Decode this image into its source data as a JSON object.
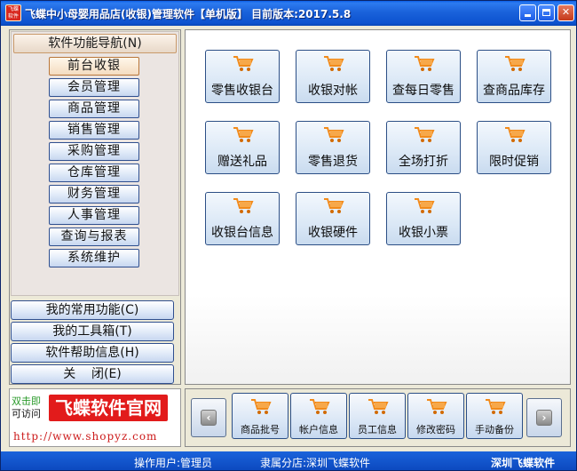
{
  "window": {
    "title": "飞蝶中小母婴用品店(收银)管理软件【单机版】 目前版本:2017.5.8",
    "icon_text": "飞蝶软件"
  },
  "nav": {
    "header": "软件功能导航(N)",
    "items": [
      {
        "label": "前台收银",
        "active": true
      },
      {
        "label": "会员管理"
      },
      {
        "label": "商品管理"
      },
      {
        "label": "销售管理"
      },
      {
        "label": "采购管理"
      },
      {
        "label": "仓库管理"
      },
      {
        "label": "财务管理"
      },
      {
        "label": "人事管理"
      },
      {
        "label": "查询与报表"
      },
      {
        "label": "系统维护"
      }
    ],
    "lower": [
      {
        "label": "我的常用功能(C)"
      },
      {
        "label": "我的工具箱(T)"
      },
      {
        "label": "软件帮助信息(H)"
      },
      {
        "label": "关    闭(E)"
      }
    ]
  },
  "logo": {
    "line1": "双击即",
    "line2": "可访问",
    "main": "飞蝶软件官网",
    "url": "http://www.shopyz.com"
  },
  "tiles": [
    {
      "label": "零售收银台"
    },
    {
      "label": "收银对帐"
    },
    {
      "label": "查每日零售"
    },
    {
      "label": "查商品库存"
    },
    {
      "label": "赠送礼品"
    },
    {
      "label": "零售退货"
    },
    {
      "label": "全场打折"
    },
    {
      "label": "限时促销"
    },
    {
      "label": "收银台信息"
    },
    {
      "label": "收银硬件"
    },
    {
      "label": "收银小票"
    }
  ],
  "toolbar": [
    {
      "label": "商品批号"
    },
    {
      "label": "帐户信息"
    },
    {
      "label": "员工信息"
    },
    {
      "label": "修改密码"
    },
    {
      "label": "手动备份"
    }
  ],
  "status": {
    "user": "操作用户:管理员",
    "branch": "隶属分店:深圳飞蝶软件",
    "company": "深圳飞蝶软件"
  },
  "colors": {
    "titlebar": "#1a62db",
    "cart_orange": "#f28a1a",
    "logo_red": "#e21b1b"
  }
}
